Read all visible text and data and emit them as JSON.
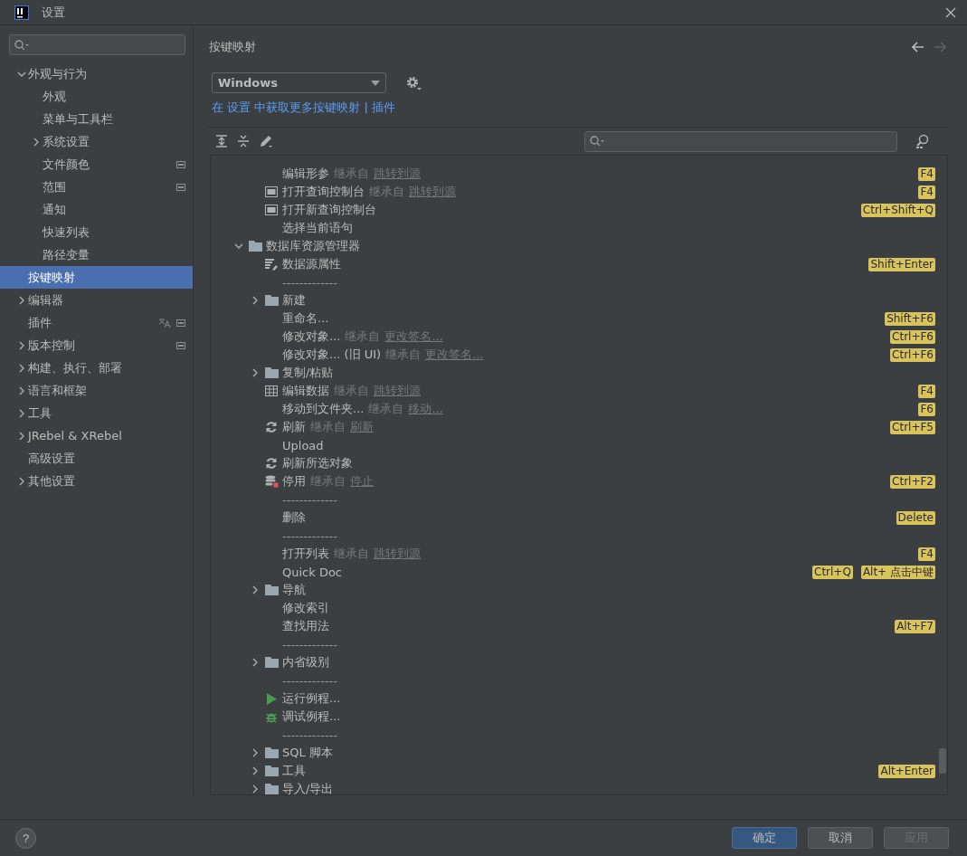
{
  "window": {
    "title": "设置"
  },
  "sidebar": {
    "items": [
      {
        "label": "外观与行为",
        "expanded": true,
        "selected": false,
        "children": [
          {
            "label": "外观",
            "selected": false
          },
          {
            "label": "菜单与工具栏",
            "selected": false
          },
          {
            "label": "系统设置",
            "expanded": false,
            "selected": false
          },
          {
            "label": "文件颜色",
            "selected": false,
            "project_level": true
          },
          {
            "label": "范围",
            "selected": false,
            "project_level": true
          },
          {
            "label": "通知",
            "selected": false
          },
          {
            "label": "快速列表",
            "selected": false
          },
          {
            "label": "路径变量",
            "selected": false
          }
        ]
      },
      {
        "label": "按键映射",
        "selected": true
      },
      {
        "label": "编辑器",
        "expanded": false,
        "selected": false
      },
      {
        "label": "插件",
        "selected": false,
        "translatable": true,
        "project_level": true
      },
      {
        "label": "版本控制",
        "expanded": false,
        "selected": false,
        "project_level": true
      },
      {
        "label": "构建、执行、部署",
        "expanded": false,
        "selected": false
      },
      {
        "label": "语言和框架",
        "expanded": false,
        "selected": false
      },
      {
        "label": "工具",
        "expanded": false,
        "selected": false
      },
      {
        "label": "JRebel & XRebel",
        "expanded": false,
        "selected": false
      },
      {
        "label": "高级设置",
        "selected": false
      },
      {
        "label": "其他设置",
        "expanded": false,
        "selected": false
      }
    ]
  },
  "page": {
    "title": "按键映射",
    "back_enabled": true,
    "forward_enabled": false,
    "keymap_select": {
      "value": "Windows"
    },
    "more_keymaps": "在 设置 中获取更多按键映射 | 插件",
    "tree": [
      {
        "kind": "continuation",
        "children": [
          {
            "kind": "plain",
            "label": "编辑形参",
            "inherited": "继承自",
            "source": "跳转到源",
            "shortcuts": [
              "F4"
            ]
          },
          {
            "kind": "console",
            "label": "打开查询控制台",
            "inherited": "继承自",
            "source": "跳转到源",
            "shortcuts": [
              "F4"
            ]
          },
          {
            "kind": "console",
            "label": "打开新查询控制台",
            "shortcuts": [
              "Ctrl+Shift+Q"
            ]
          },
          {
            "kind": "plain",
            "label": "选择当前语句"
          }
        ]
      },
      {
        "kind": "folder",
        "label": "数据库资源管理器",
        "expanded": true,
        "children": [
          {
            "kind": "datasource",
            "label": "数据源属性",
            "shortcuts": [
              "Shift+Enter"
            ]
          },
          {
            "kind": "separator",
            "label": "-------------"
          },
          {
            "kind": "folder",
            "label": "新建",
            "expanded": false
          },
          {
            "kind": "plain",
            "label": "重命名...",
            "shortcuts": [
              "Shift+F6"
            ]
          },
          {
            "kind": "plain",
            "label": "修改对象...",
            "inherited": "继承自",
            "source": "更改签名...",
            "shortcuts": [
              "Ctrl+F6"
            ]
          },
          {
            "kind": "plain",
            "label": "修改对象... (旧 UI)",
            "inherited": "继承自",
            "source": "更改签名...",
            "shortcuts": [
              "Ctrl+F6"
            ]
          },
          {
            "kind": "folder",
            "label": "复制/粘贴",
            "expanded": false
          },
          {
            "kind": "table",
            "label": "编辑数据",
            "inherited": "继承自",
            "source": "跳转到源",
            "shortcuts": [
              "F4"
            ]
          },
          {
            "kind": "plain",
            "label": "移动到文件夹...",
            "inherited": "继承自",
            "source": "移动...",
            "shortcuts": [
              "F6"
            ]
          },
          {
            "kind": "refresh",
            "label": "刷新",
            "inherited": "继承自",
            "source": "刷新",
            "shortcuts": [
              "Ctrl+F5"
            ]
          },
          {
            "kind": "plain",
            "label": "Upload"
          },
          {
            "kind": "refresh",
            "label": "刷新所选对象"
          },
          {
            "kind": "stop",
            "label": "停用",
            "inherited": "继承自",
            "source": "停止",
            "shortcuts": [
              "Ctrl+F2"
            ]
          },
          {
            "kind": "separator",
            "label": "-------------"
          },
          {
            "kind": "plain",
            "label": "删除",
            "shortcuts": [
              "Delete"
            ]
          },
          {
            "kind": "separator",
            "label": "-------------"
          },
          {
            "kind": "plain",
            "label": "打开列表",
            "inherited": "继承自",
            "source": "跳转到源",
            "shortcuts": [
              "F4"
            ]
          },
          {
            "kind": "plain",
            "label": "Quick Doc",
            "shortcuts": [
              "Ctrl+Q",
              "Alt+ 点击中键"
            ]
          },
          {
            "kind": "folder",
            "label": "导航",
            "expanded": false
          },
          {
            "kind": "plain",
            "label": "修改索引"
          },
          {
            "kind": "plain",
            "label": "查找用法",
            "shortcuts": [
              "Alt+F7"
            ]
          },
          {
            "kind": "separator",
            "label": "-------------"
          },
          {
            "kind": "folder",
            "label": "内省级别",
            "expanded": false
          },
          {
            "kind": "separator",
            "label": "-------------"
          },
          {
            "kind": "run",
            "label": "运行例程..."
          },
          {
            "kind": "debug",
            "label": "调试例程..."
          },
          {
            "kind": "separator",
            "label": "-------------"
          },
          {
            "kind": "folder",
            "label": "SQL 脚本",
            "expanded": false
          },
          {
            "kind": "folder",
            "label": "工具",
            "expanded": false,
            "shortcuts": [
              "Alt+Enter"
            ]
          },
          {
            "kind": "folder",
            "label": "导入/导出",
            "expanded": false
          }
        ]
      }
    ]
  },
  "footer": {
    "help": "?",
    "buttons": [
      {
        "label": "确定",
        "primary": true,
        "disabled": false
      },
      {
        "label": "取消",
        "primary": false,
        "disabled": false
      },
      {
        "label": "应用",
        "primary": false,
        "disabled": true
      }
    ]
  }
}
